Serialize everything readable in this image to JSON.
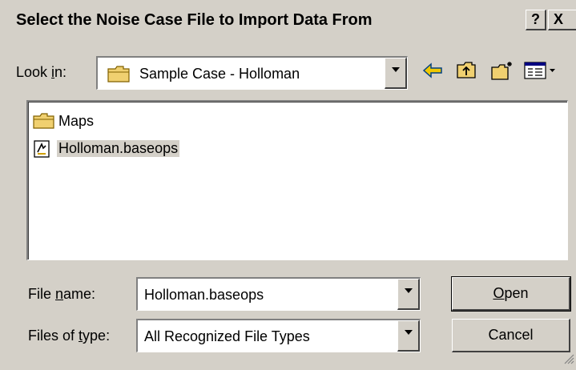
{
  "dialog": {
    "title": "Select the Noise Case File to Import Data From",
    "help_label": "?",
    "close_label": "X"
  },
  "look_in": {
    "label_before": "Look ",
    "label_accel": "i",
    "label_after": "n:",
    "value": "Sample Case - Holloman"
  },
  "toolbar": {
    "icons": [
      "back-arrow-icon",
      "up-one-level-icon",
      "create-new-folder-icon",
      "view-menu-icon"
    ]
  },
  "file_list": {
    "items": [
      {
        "label": "Maps",
        "icon": "folder-icon",
        "selected": false
      },
      {
        "label": "Holloman.baseops",
        "icon": "baseops-file-icon",
        "selected": true
      }
    ]
  },
  "file_name": {
    "label_before": "File ",
    "label_accel": "n",
    "label_after": "ame:",
    "value": "Holloman.baseops"
  },
  "file_type": {
    "label_before": "Files of ",
    "label_accel": "t",
    "label_after": "ype:",
    "value": "All Recognized File Types"
  },
  "buttons": {
    "open_accel": "O",
    "open_rest": "pen",
    "cancel": "Cancel"
  },
  "colors": {
    "face": "#d4d0c8",
    "folder": "#f0d070",
    "back_arrow": "#f0c800"
  }
}
